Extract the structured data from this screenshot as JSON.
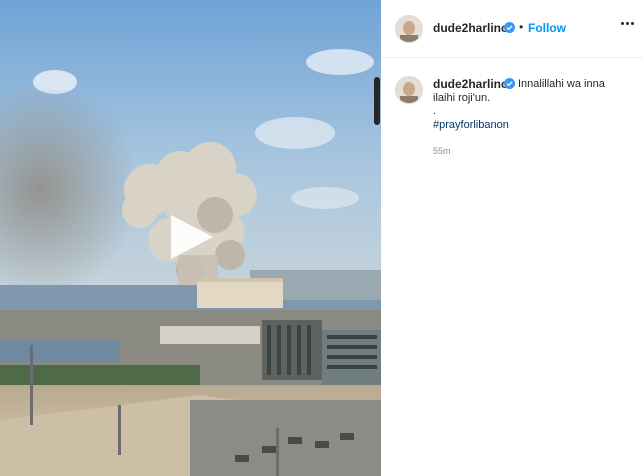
{
  "post": {
    "username": "dude2harlino",
    "follow_separator": "•",
    "follow_label": "Follow",
    "caption_line1": "Innalillahi wa inna",
    "caption_line2": "ilaihi roji'un.",
    "caption_line3": ".",
    "hashtag": "#prayforlibanon",
    "timestamp": "55m"
  },
  "icons": {
    "verified": "verified-badge-icon",
    "more": "more-options-icon",
    "play": "play-icon"
  },
  "colors": {
    "accent": "#0095f6",
    "verified": "#3897f0",
    "hashtag": "#00376b",
    "muted": "#8e8e8e"
  }
}
